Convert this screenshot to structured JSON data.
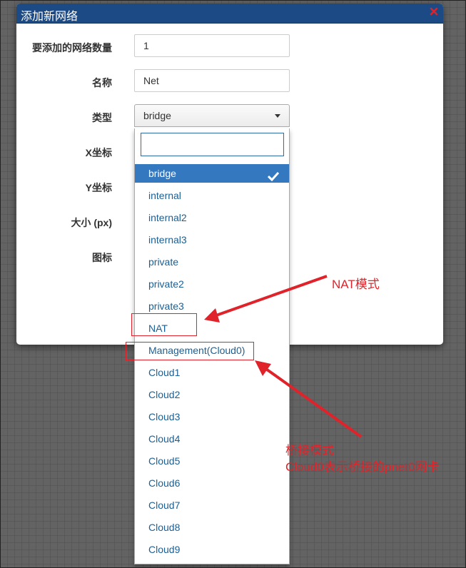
{
  "modal": {
    "title": "添加新网络",
    "fields": {
      "count_label": "要添加的网络数量",
      "count_value": "1",
      "name_label": "名称",
      "name_value": "Net",
      "type_label": "类型",
      "type_value": "bridge",
      "x_label": "X坐标",
      "y_label": "Y坐标",
      "size_label": "大小 (px)",
      "icon_label": "图标"
    }
  },
  "dropdown": {
    "search_value": "",
    "selected": "bridge",
    "options": [
      "bridge",
      "internal",
      "internal2",
      "internal3",
      "private",
      "private2",
      "private3",
      "NAT",
      "Management(Cloud0)",
      "Cloud1",
      "Cloud2",
      "Cloud3",
      "Cloud4",
      "Cloud5",
      "Cloud6",
      "Cloud7",
      "Cloud8",
      "Cloud9"
    ]
  },
  "annotations": {
    "nat_note": "NAT模式",
    "bridge_note_line1": "桥接模式",
    "bridge_note_line2": "Cloud0表示桥接的pnet0网卡",
    "color": "#e0232a"
  },
  "colors": {
    "header_bg": "#1c4a85",
    "selected_bg": "#3478c0",
    "option_text": "#1a5f94"
  }
}
